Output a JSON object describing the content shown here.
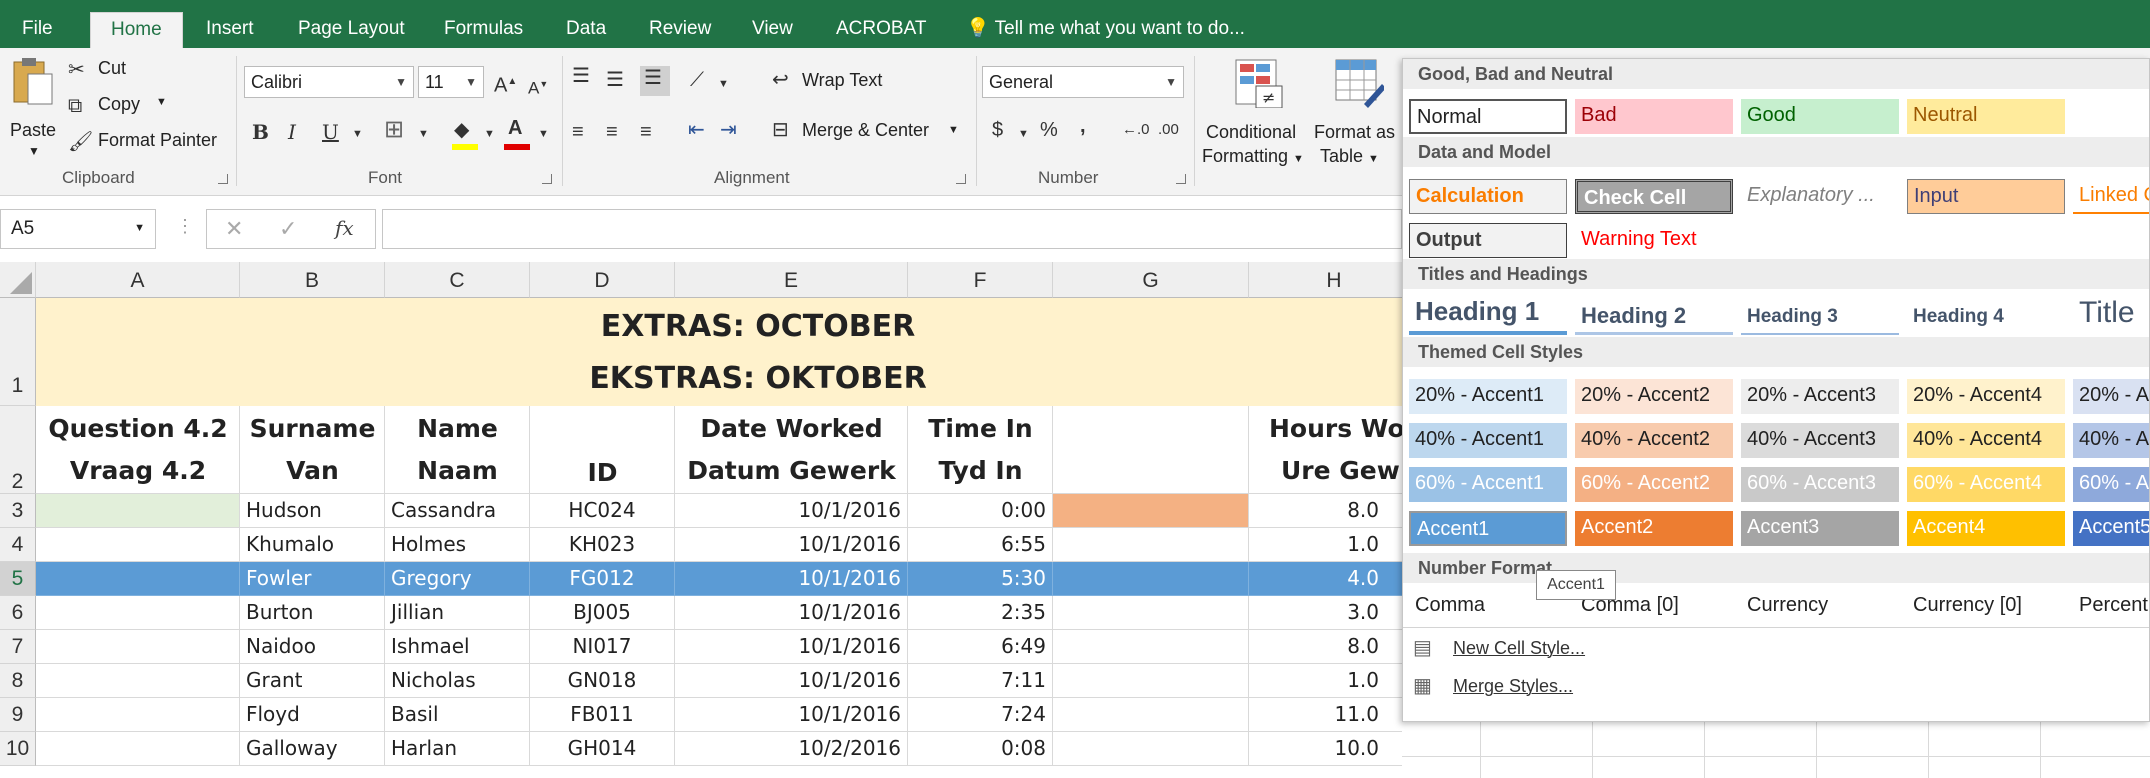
{
  "tabs": [
    "File",
    "Home",
    "Insert",
    "Page Layout",
    "Formulas",
    "Data",
    "Review",
    "View",
    "ACROBAT"
  ],
  "tell_me": "Tell me what you want to do...",
  "clipboard": {
    "paste": "Paste",
    "cut": "Cut",
    "copy": "Copy",
    "format_painter": "Format Painter",
    "label": "Clipboard"
  },
  "font": {
    "name": "Calibri",
    "size": "11",
    "bold": "B",
    "italic": "I",
    "underline": "U",
    "label": "Font"
  },
  "alignment": {
    "wrap": "Wrap Text",
    "merge": "Merge & Center",
    "label": "Alignment"
  },
  "number": {
    "format": "General",
    "currency": "$",
    "percent": "%",
    "comma": ",",
    "label": "Number"
  },
  "styles": {
    "conditional_1": "Conditional",
    "conditional_2": "Formatting",
    "format_table_1": "Format as",
    "format_table_2": "Table"
  },
  "formula_bar": {
    "name_box": "A5",
    "fx": "fx",
    "cancel": "✕",
    "enter": "✓"
  },
  "columns": [
    "A",
    "B",
    "C",
    "D",
    "E",
    "F",
    "G",
    "H"
  ],
  "rows": [
    "1",
    "2",
    "3",
    "4",
    "5",
    "6",
    "7",
    "8",
    "9",
    "10"
  ],
  "title1": "EXTRAS: OCTOBER",
  "title2": "EKSTRAS: OKTOBER",
  "headers": {
    "a1": "Question 4.2",
    "a2": "Vraag 4.2",
    "b1": "Surname",
    "b2": "Van",
    "c1": "Name",
    "c2": "Naam",
    "d2": "ID",
    "e1": "Date Worked",
    "e2": "Datum Gewerk",
    "f1": "Time In",
    "f2": "Tyd In",
    "h1": "Hours Wo",
    "h2": "Ure Gew"
  },
  "data_rows": [
    {
      "surname": "Hudson",
      "name": "Cassandra",
      "id": "HC024",
      "date": "10/1/2016",
      "time": "0:00",
      "hours": "8.0"
    },
    {
      "surname": "Khumalo",
      "name": "Holmes",
      "id": "KH023",
      "date": "10/1/2016",
      "time": "6:55",
      "hours": "1.0"
    },
    {
      "surname": "Fowler",
      "name": "Gregory",
      "id": "FG012",
      "date": "10/1/2016",
      "time": "5:30",
      "hours": "4.0"
    },
    {
      "surname": "Burton",
      "name": "Jillian",
      "id": "BJ005",
      "date": "10/1/2016",
      "time": "2:35",
      "hours": "3.0"
    },
    {
      "surname": "Naidoo",
      "name": "Ishmael",
      "id": "NI017",
      "date": "10/1/2016",
      "time": "6:49",
      "hours": "8.0"
    },
    {
      "surname": "Grant",
      "name": "Nicholas",
      "id": "GN018",
      "date": "10/1/2016",
      "time": "7:11",
      "hours": "1.0"
    },
    {
      "surname": "Floyd",
      "name": "Basil",
      "id": "FB011",
      "date": "10/1/2016",
      "time": "7:24",
      "hours": "11.0"
    },
    {
      "surname": "Galloway",
      "name": "Harlan",
      "id": "GH014",
      "date": "10/2/2016",
      "time": "0:08",
      "hours": "10.0"
    }
  ],
  "gallery": {
    "sections": [
      "Good, Bad and Neutral",
      "Data and Model",
      "Titles and Headings",
      "Themed Cell Styles",
      "Number Format"
    ],
    "good_bad": [
      "Normal",
      "Bad",
      "Good",
      "Neutral"
    ],
    "data_model_1": [
      "Calculation",
      "Check Cell",
      "Explanatory ...",
      "Input",
      "Linked C"
    ],
    "data_model_2": [
      "Output",
      "Warning Text"
    ],
    "titles": [
      "Heading 1",
      "Heading 2",
      "Heading 3",
      "Heading 4",
      "Title"
    ],
    "themed_20": [
      "20% - Accent1",
      "20% - Accent2",
      "20% - Accent3",
      "20% - Accent4",
      "20% - Ac"
    ],
    "themed_40": [
      "40% - Accent1",
      "40% - Accent2",
      "40% - Accent3",
      "40% - Accent4",
      "40% - Ac"
    ],
    "themed_60": [
      "60% - Accent1",
      "60% - Accent2",
      "60% - Accent3",
      "60% - Accent4",
      "60% - Ac"
    ],
    "accents": [
      "Accent1",
      "Accent2",
      "Accent3",
      "Accent4",
      "Accent5"
    ],
    "number_formats": [
      "Comma",
      "Comma [0]",
      "Currency",
      "Currency [0]",
      "Percent"
    ],
    "new_style": "New Cell Style...",
    "merge_styles": "Merge Styles...",
    "tooltip": "Accent1"
  },
  "colors": {
    "accent": "#217346",
    "selected_row": "#5b9bd5",
    "header_fill": "#fff2cc"
  }
}
